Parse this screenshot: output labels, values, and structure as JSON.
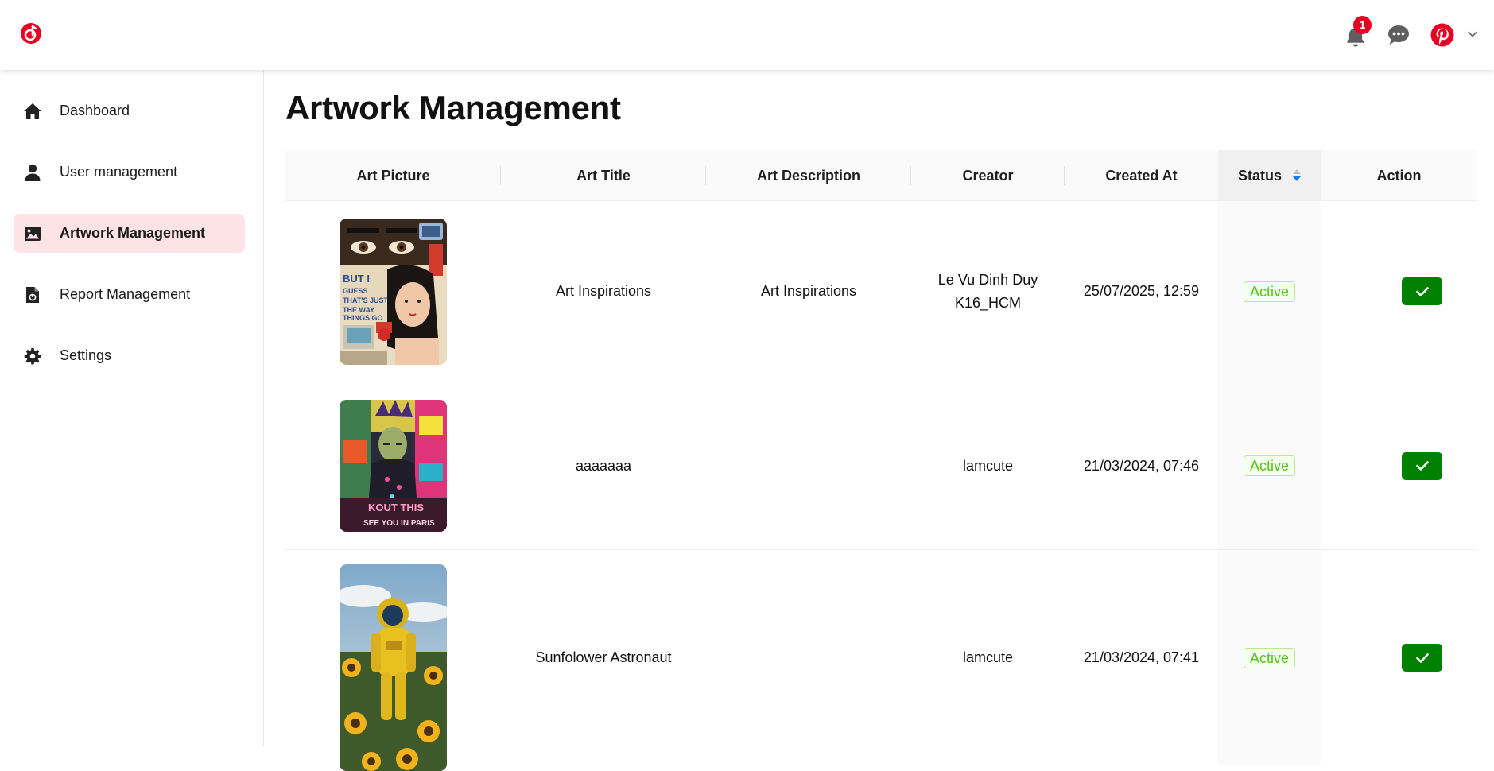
{
  "header": {
    "notification_count": "1",
    "brand_color": "#e60023"
  },
  "sidebar": {
    "items": [
      {
        "label": "Dashboard",
        "icon": "home-icon"
      },
      {
        "label": "User management",
        "icon": "user-icon"
      },
      {
        "label": "Artwork Management",
        "icon": "image-icon",
        "active": true
      },
      {
        "label": "Report Management",
        "icon": "report-file-icon"
      },
      {
        "label": "Settings",
        "icon": "gear-icon"
      }
    ]
  },
  "main": {
    "title": "Artwork Management",
    "table": {
      "columns": [
        "Art Picture",
        "Art Title",
        "Art Description",
        "Creator",
        "Created At",
        "Status",
        "Action"
      ],
      "rows": [
        {
          "title": "Art Inspirations",
          "description": "Art Inspirations",
          "creator_line1": "Le Vu Dinh Duy",
          "creator_line2": "K16_HCM",
          "created_at": "25/07/2025, 12:59",
          "status": "Active",
          "picture": "collage-portrait-picture"
        },
        {
          "title": "aaaaaaa",
          "description": "",
          "creator_line1": "lamcute",
          "creator_line2": "",
          "created_at": "21/03/2024, 07:46",
          "status": "Active",
          "picture": "graffiti-mona-lisa-picture"
        },
        {
          "title": "Sunfolower Astronaut",
          "description": "",
          "creator_line1": "lamcute",
          "creator_line2": "",
          "created_at": "21/03/2024, 07:41",
          "status": "Active",
          "picture": "astronaut-sunflowers-picture"
        }
      ]
    }
  }
}
